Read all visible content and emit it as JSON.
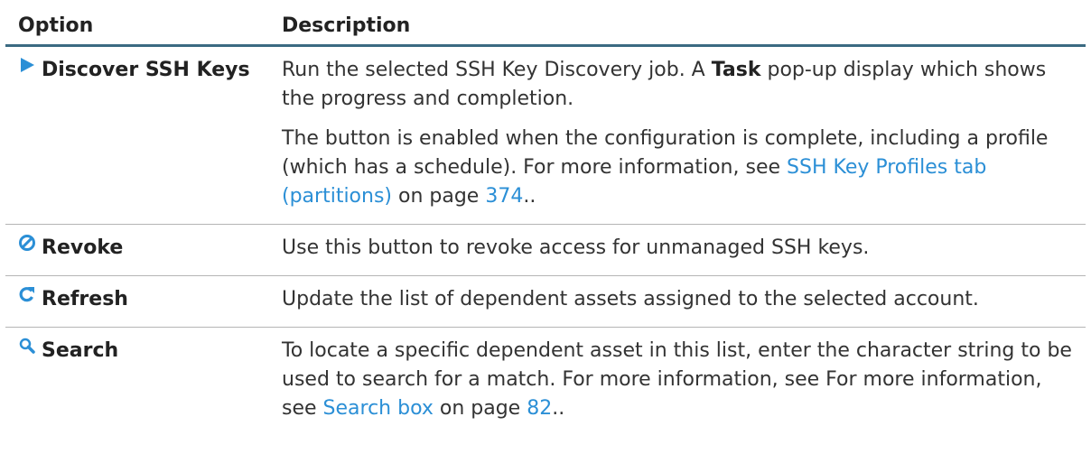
{
  "header": {
    "option": "Option",
    "description": "Description"
  },
  "rows": [
    {
      "option": "Discover SSH Keys",
      "icon": "play-icon",
      "p1_before": "Run the selected SSH Key Discovery job. A ",
      "p1_bold": "Task",
      "p1_after": " pop-up display which shows the progress and completion.",
      "p2_before": "The button is enabled when the configuration is complete, including a profile (which has a schedule). For more information, see ",
      "p2_link": "SSH Key Profiles tab (partitions)",
      "p2_mid": " on page ",
      "p2_page": "374",
      "p2_after": ".."
    },
    {
      "option": "Revoke",
      "icon": "revoke-icon",
      "desc": "Use this button to revoke access for unmanaged SSH keys."
    },
    {
      "option": "Refresh",
      "icon": "refresh-icon",
      "desc": "Update the list of dependent assets assigned to the selected account."
    },
    {
      "option": "Search",
      "icon": "search-icon",
      "desc_before": "To locate a specific dependent asset in this list, enter the character string to be used to search for a match. For more information, see For more information, see ",
      "link": "Search box",
      "mid": " on page ",
      "page": "82",
      "after": ".."
    }
  ],
  "colors": {
    "link": "#2b8fd6",
    "icon": "#2b8fd6",
    "header_rule": "#3b6a82"
  }
}
